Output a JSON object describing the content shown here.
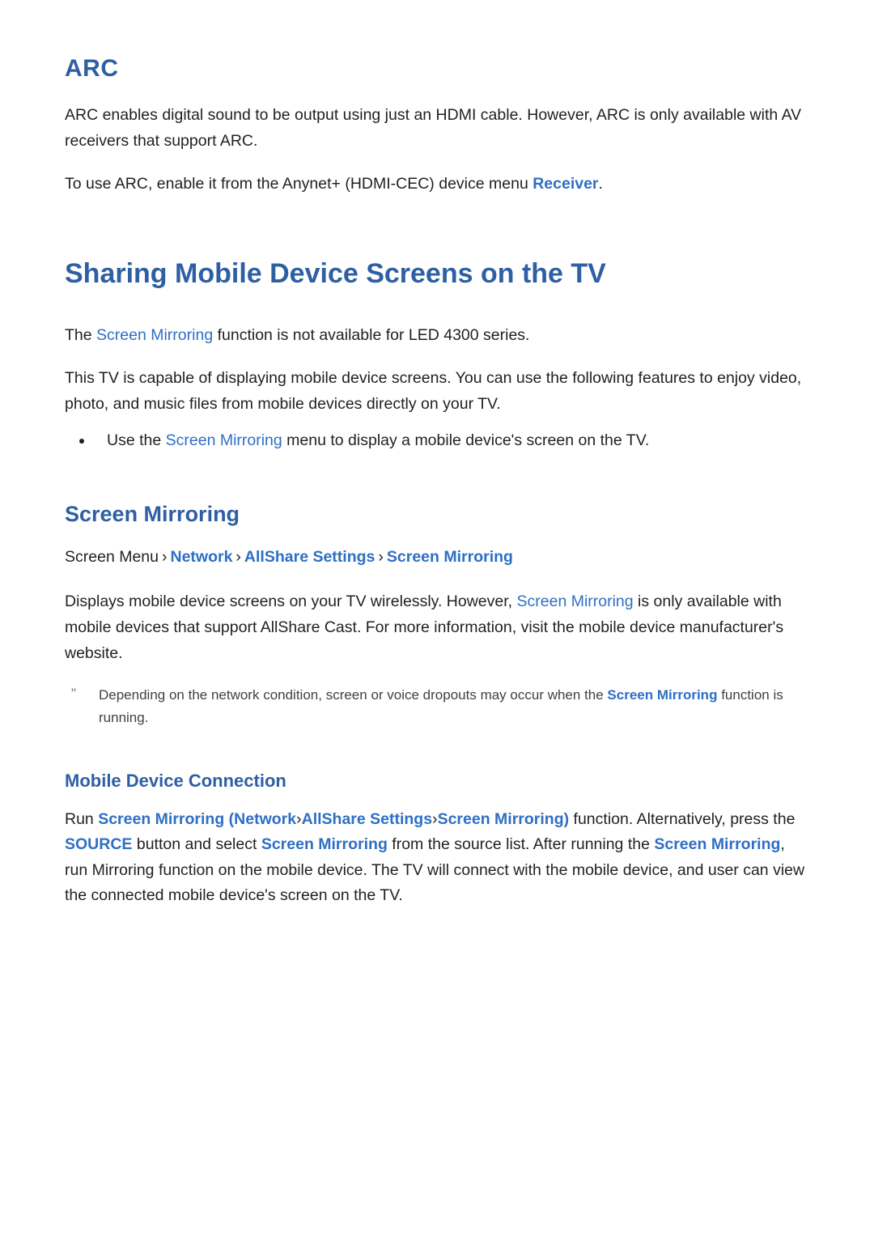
{
  "sections": {
    "arc": {
      "heading": "ARC",
      "p1_a": "ARC enables digital sound to be output using just an HDMI cable. However, ARC is only available with AV receivers that support ARC.",
      "p2_a": "To use ARC, enable it from the Anynet+ (HDMI-CEC) device menu ",
      "p2_link": "Receiver",
      "p2_b": "."
    },
    "sharing": {
      "heading": "Sharing Mobile Device Screens on the TV",
      "p1_a": "The ",
      "p1_link": "Screen Mirroring",
      "p1_b": " function is not available for LED 4300 series.",
      "p2": "This TV is capable of displaying mobile device screens. You can use the following features to enjoy video, photo, and music files from mobile devices directly on your TV.",
      "bullet1_a": "Use the ",
      "bullet1_link": "Screen Mirroring",
      "bullet1_b": " menu to display a mobile device's screen on the TV."
    },
    "screen_mirroring": {
      "heading": "Screen Mirroring",
      "menu_path": {
        "root": "Screen Menu",
        "sep": "›",
        "items": [
          "Network",
          "AllShare Settings",
          "Screen Mirroring"
        ]
      },
      "p1_a": "Displays mobile device screens on your TV wirelessly. However, ",
      "p1_link": "Screen Mirroring",
      "p1_b": " is only available with mobile devices that support AllShare Cast. For more information, visit the mobile device manufacturer's website.",
      "note_a": "Depending on the network condition, screen or voice dropouts may occur when the ",
      "note_link": "Screen Mirroring",
      "note_b": " function is running.",
      "note_marker": "\""
    },
    "mobile_device_connection": {
      "heading": "Mobile Device Connection",
      "run_label": "Run ",
      "link_screen_mirroring_1": "Screen Mirroring",
      "paren_open": " (",
      "link_network": "Network",
      "sep": "›",
      "link_allshare": "AllShare Settings",
      "link_screen_mirroring_2": "Screen Mirroring",
      "paren_close": ")",
      "mid_1": " function. Alternatively, press the ",
      "link_source": "SOURCE",
      "mid_2": " button and select ",
      "link_screen_mirroring_3": "Screen Mirroring",
      "mid_3": " from the source list. After running the ",
      "link_screen_mirroring_4": "Screen Mirroring",
      "tail": ", run Mirroring function on the mobile device. The TV will connect with the mobile device, and user can view the connected mobile device's screen on the TV."
    }
  },
  "colors": {
    "heading_blue": "#2e5fa3",
    "link_blue": "#2e6fc4",
    "body_text": "#231f20",
    "note_text": "#444041"
  }
}
